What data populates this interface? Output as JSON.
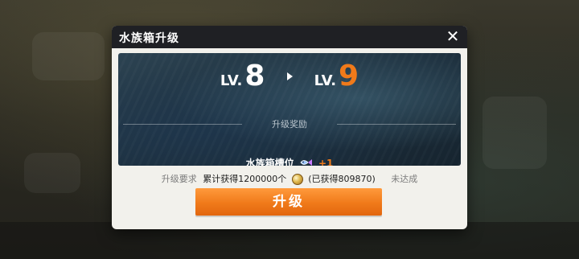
{
  "dialog": {
    "title": "水族箱升级",
    "close_icon": "close-icon",
    "level": {
      "prefix_current": "LV.",
      "current": "8",
      "prefix_next": "LV.",
      "next": "9"
    },
    "reward_title": "升级奖励",
    "reward": {
      "label": "水族箱槽位",
      "icon": "fish-tank-slot-icon",
      "bonus": "+1"
    },
    "requirement": {
      "label": "升级要求",
      "need": "累计获得1200000个",
      "coin_icon": "shell-coin-icon",
      "have": "(已获得809870)",
      "status": "未达成"
    },
    "upgrade_button_label": "升级"
  },
  "colors": {
    "accent": "#f07a1a",
    "header": "#1f2024",
    "panel": "#f2f1ec"
  }
}
